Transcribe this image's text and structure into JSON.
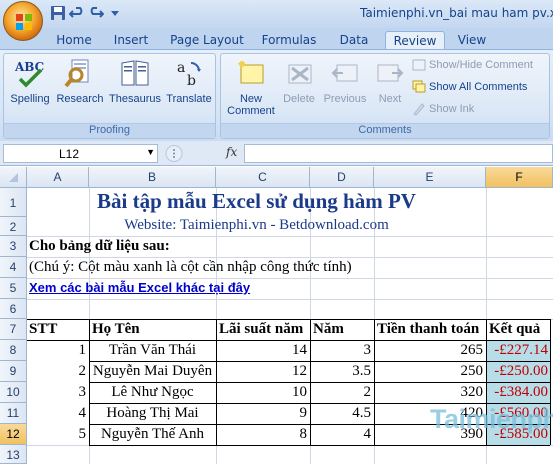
{
  "window": {
    "title": "Taimienphi.vn_bai mau ham pv.xlsx"
  },
  "tabs": [
    "Home",
    "Insert",
    "Page Layout",
    "Formulas",
    "Data",
    "Review",
    "View"
  ],
  "active_tab": "Review",
  "ribbon": {
    "proofing": {
      "label": "Proofing",
      "buttons": [
        "Spelling",
        "Research",
        "Thesaurus",
        "Translate"
      ]
    },
    "comments": {
      "label": "Comments",
      "new_comment": [
        "New",
        "Comment"
      ],
      "delete": "Delete",
      "previous": "Previous",
      "next": "Next",
      "show_hide": "Show/Hide Comment",
      "show_all": "Show All Comments",
      "show_ink": "Show Ink"
    }
  },
  "formula_bar": {
    "name_box": "L12",
    "fx": "fx",
    "value": ""
  },
  "columns": [
    "A",
    "B",
    "C",
    "D",
    "E",
    "F"
  ],
  "rows": [
    "1",
    "2",
    "3",
    "4",
    "5",
    "6",
    "7",
    "8",
    "9",
    "10",
    "11",
    "12",
    "13"
  ],
  "active_cell": {
    "col": "F",
    "row": "12"
  },
  "sheet": {
    "title": "Bài tập mẫu Excel sử dụng hàm PV",
    "website": "Website: Taimienphi.vn - Betdownload.com",
    "intro": "Cho bảng dữ liệu sau:",
    "note": "(Chú ý: Cột màu xanh là cột cần nhập công thức tính)",
    "link": "Xem các bài mẫu Excel khác tại đây",
    "headers": [
      "STT",
      "Họ Tên",
      "Lãi suất năm",
      "Năm",
      "Tiền thanh toán",
      "Kết quả"
    ],
    "records": [
      {
        "stt": "1",
        "name": "Trần Văn Thái",
        "rate": "14",
        "years": "3",
        "payment": "265",
        "result": "-£227.14"
      },
      {
        "stt": "2",
        "name": "Nguyễn Mai Duyên",
        "rate": "12",
        "years": "3.5",
        "payment": "250",
        "result": "-£250.00"
      },
      {
        "stt": "3",
        "name": "Lê Như Ngọc",
        "rate": "10",
        "years": "2",
        "payment": "320",
        "result": "-£384.00"
      },
      {
        "stt": "4",
        "name": "Hoàng Thị Mai",
        "rate": "9",
        "years": "4.5",
        "payment": "420",
        "result": "-£560.00"
      },
      {
        "stt": "5",
        "name": "Nguyễn Thế Anh",
        "rate": "8",
        "years": "4",
        "payment": "390",
        "result": "-£585.00"
      }
    ]
  },
  "watermark": "Taimienphi",
  "colors": {
    "result_fill": "#b7dde8",
    "result_text": "#c00000",
    "title_text": "#1a3a8a",
    "link_text": "#0000cc"
  }
}
